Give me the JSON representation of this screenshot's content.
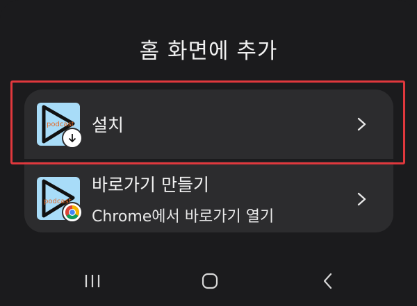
{
  "dialog": {
    "title": "홈 화면에 추가"
  },
  "options": [
    {
      "label": "설치",
      "icon": "podcast-app-icon",
      "badge": "download-icon",
      "chevron": "chevron-right-icon"
    },
    {
      "label": "바로가기 만들기",
      "sublabel": "Chrome에서 바로가기 열기",
      "icon": "podcast-app-icon",
      "badge": "chrome-icon",
      "chevron": "chevron-right-icon"
    }
  ],
  "app_icon": {
    "text": "podcast"
  },
  "highlight_color": "#e0383d",
  "navbar": {
    "recent": "recent-apps-icon",
    "home": "home-icon",
    "back": "back-icon"
  }
}
